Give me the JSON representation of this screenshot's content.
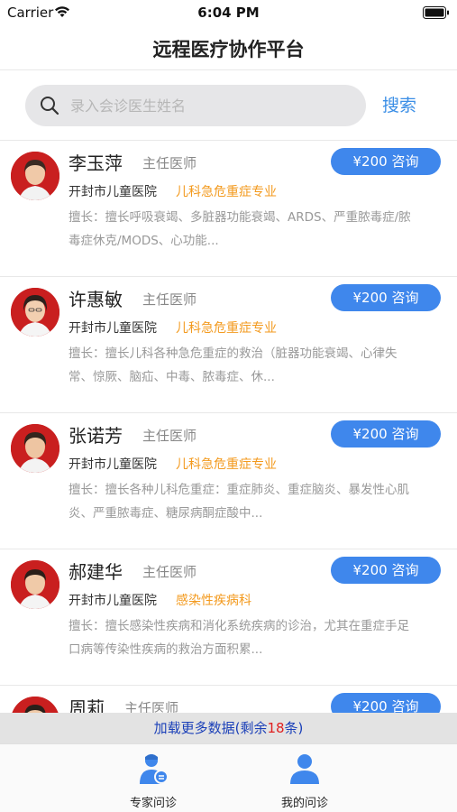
{
  "status_bar": {
    "carrier": "Carrier",
    "time": "6:04 PM"
  },
  "nav": {
    "title": "远程医疗协作平台"
  },
  "search": {
    "placeholder": "录入会诊医生姓名",
    "button_label": "搜索"
  },
  "doctors": [
    {
      "name": "李玉萍",
      "title": "主任医师",
      "price_label": "¥200 咨询",
      "hospital": "开封市儿童医院",
      "department": "儿科急危重症专业",
      "skill_label": "擅长：",
      "skill_line1": "擅长呼吸衰竭、多脏器功能衰竭、ARDS、严重脓毒症/脓",
      "skill_line2": "毒症休克/MODS、心功能..."
    },
    {
      "name": "许惠敏",
      "title": "主任医师",
      "price_label": "¥200 咨询",
      "hospital": "开封市儿童医院",
      "department": "儿科急危重症专业",
      "skill_label": "擅长：",
      "skill_line1": "擅长儿科各种急危重症的救治（脏器功能衰竭、心律失",
      "skill_line2": "常、惊厥、脑疝、中毒、脓毒症、休..."
    },
    {
      "name": "张诺芳",
      "title": "主任医师",
      "price_label": "¥200 咨询",
      "hospital": "开封市儿童医院",
      "department": "儿科急危重症专业",
      "skill_label": "擅长：",
      "skill_line1": "擅长各种儿科危重症：重症肺炎、重症脑炎、暴发性心肌",
      "skill_line2": "炎、严重脓毒症、糖尿病酮症酸中..."
    },
    {
      "name": "郝建华",
      "title": "主任医师",
      "price_label": "¥200 咨询",
      "hospital": "开封市儿童医院",
      "department": "感染性疾病科",
      "skill_label": "擅长：",
      "skill_line1": "擅长感染性疾病和消化系统疾病的诊治，尤其在重症手足",
      "skill_line2": "口病等传染性疾病的救治方面积累..."
    },
    {
      "name": "周莉",
      "title": "主任医师",
      "price_label": "¥200 咨询",
      "hospital": "",
      "department": "",
      "skill_label": "",
      "skill_line1": "",
      "skill_line2": ""
    }
  ],
  "load_more": {
    "prefix": "加载更多数据(剩余",
    "count": "18",
    "suffix": "条)"
  },
  "tabs": [
    {
      "label": "专家问诊",
      "icon": "doctor-icon"
    },
    {
      "label": "我的问诊",
      "icon": "user-icon"
    }
  ],
  "colors": {
    "accent": "#3f87ec",
    "department": "#f39a1e",
    "load_more_text": "#1a3fb8",
    "count_red": "#e02020"
  }
}
